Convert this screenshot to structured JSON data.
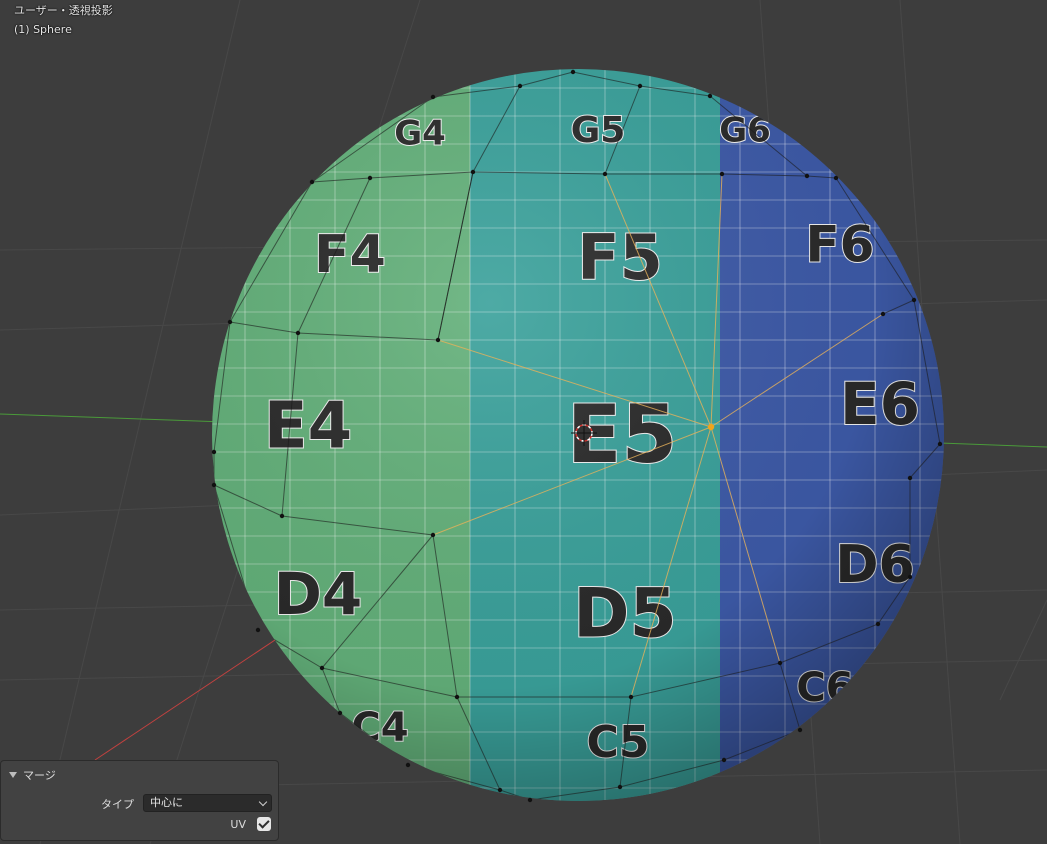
{
  "viewport": {
    "header_title": "ユーザー・透視投影",
    "object_label": "(1) Sphere",
    "colors": {
      "background": "#3d3d3d",
      "grid_line": "#4a4a4a",
      "x_axis": "#c2413f",
      "y_axis": "#4a9a3a",
      "selected_vertex": "#f0a51c"
    }
  },
  "sphere": {
    "object_name": "Sphere",
    "colors": {
      "green": "#63b07a",
      "teal": "#3aa19b",
      "blue": "#3d5aa8"
    },
    "cells": [
      {
        "label": "G4"
      },
      {
        "label": "G5"
      },
      {
        "label": "G6"
      },
      {
        "label": "F4"
      },
      {
        "label": "F5"
      },
      {
        "label": "F6"
      },
      {
        "label": "E4"
      },
      {
        "label": "E5"
      },
      {
        "label": "E6"
      },
      {
        "label": "D4"
      },
      {
        "label": "D5"
      },
      {
        "label": "D6"
      },
      {
        "label": "C4"
      },
      {
        "label": "C5"
      },
      {
        "label": "C6"
      }
    ]
  },
  "operator_panel": {
    "title": "マージ",
    "type_label": "タイプ",
    "type_value": "中心に",
    "uv_label": "UV",
    "uv_checked": true
  }
}
